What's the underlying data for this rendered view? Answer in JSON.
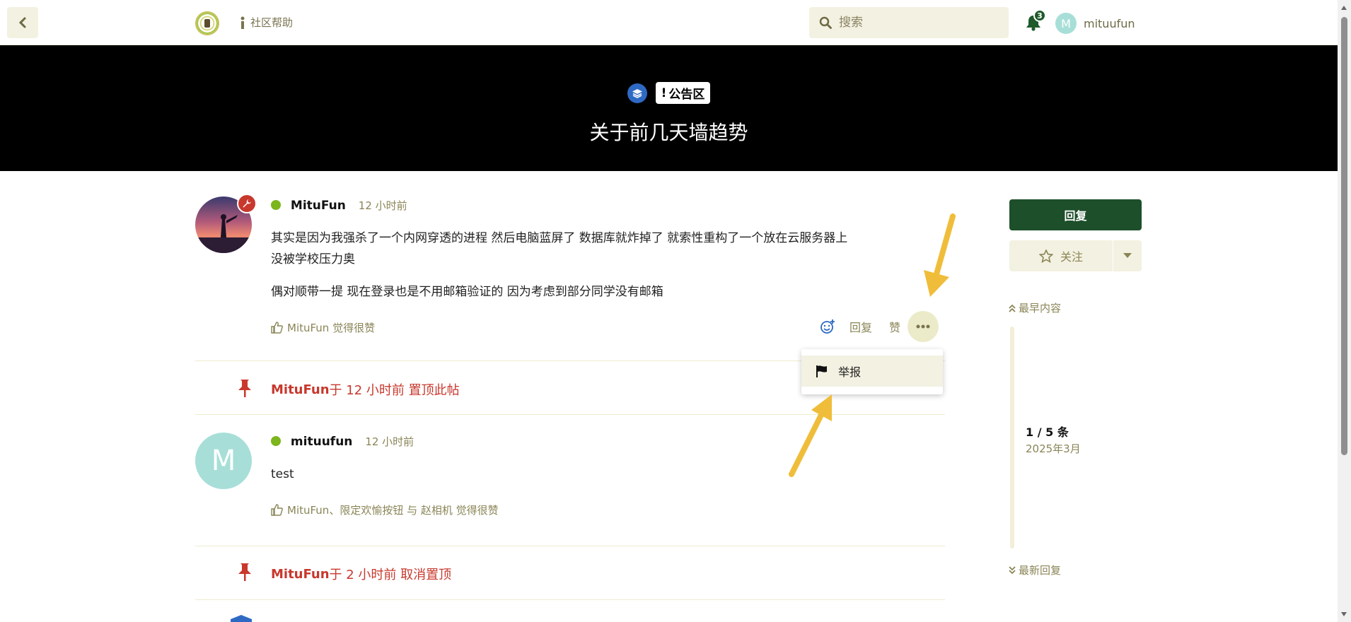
{
  "header": {
    "help_label": "社区帮助",
    "search_placeholder": "搜索",
    "notification_count": "3",
    "user_initial": "M",
    "user_name": "mituufun"
  },
  "topic": {
    "category": "公告区",
    "title": "关于前几天墙趋势"
  },
  "posts": [
    {
      "author": "MituFun",
      "time": "12 小时前",
      "paragraphs": [
        "其实是因为我强杀了一个内网穿透的进程 然后电脑蓝屏了 数据库就炸掉了 就索性重构了一个放在云服务器上",
        "没被学校压力奥",
        "偶对顺带一提 现在登录也是不用邮箱验证的 因为考虑到部分同学没有邮箱"
      ],
      "likes": "MituFun 觉得很赞",
      "actions": {
        "reply": "回复",
        "like": "赞"
      }
    },
    {
      "author": "mituufun",
      "avatar_initial": "M",
      "time": "12 小时前",
      "body": "test",
      "likes": "MituFun、限定欢愉按钮 与 赵相机 觉得很赞"
    }
  ],
  "events": [
    {
      "user": "MituFun",
      "text": " 于 12 小时前 置顶此帖"
    },
    {
      "user": "MituFun",
      "text": " 于 2 小时前 取消置顶"
    }
  ],
  "dropdown": {
    "report_label": "举报"
  },
  "sidebar": {
    "reply_label": "回复",
    "follow_label": "关注",
    "earliest_label": "最早内容",
    "latest_label": "最新回复",
    "position": "1 / 5 条",
    "date": "2025年3月"
  },
  "colors": {
    "accent_green": "#1d4f2a",
    "beige": "#f3f1e1",
    "red": "#c8382d",
    "banner_bg": "#000000",
    "online": "#7cb51c"
  }
}
